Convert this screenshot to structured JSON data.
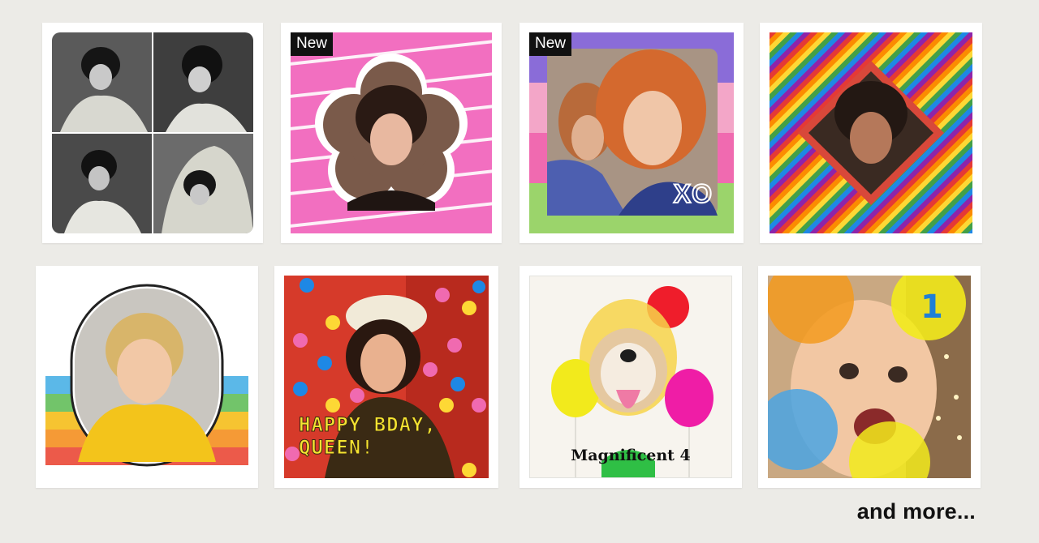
{
  "tiles": [
    {
      "name": "bw-photo-grid"
    },
    {
      "name": "flower-frame",
      "badge": "New"
    },
    {
      "name": "xo-stripes-frame",
      "badge": "New",
      "stamp": "XO"
    },
    {
      "name": "rainbow-diamond-frame"
    },
    {
      "name": "retro-rainbow-arch-frame"
    },
    {
      "name": "confetti-bday",
      "caption_line1": "HAPPY BDAY,",
      "caption_line2": "QUEEN!"
    },
    {
      "name": "balloon-dog",
      "caption": "Magnificent 4"
    },
    {
      "name": "balloon-baby",
      "number": "1"
    }
  ],
  "more_label": "and more...",
  "colors": {
    "background": "#ecebe7",
    "card": "#ffffff",
    "badge_bg": "#111111",
    "pink": "#f26fc0",
    "xo_purple": "#8a6cd8",
    "xo_pink": "#f06ab0",
    "xo_green": "#9bd46b"
  }
}
